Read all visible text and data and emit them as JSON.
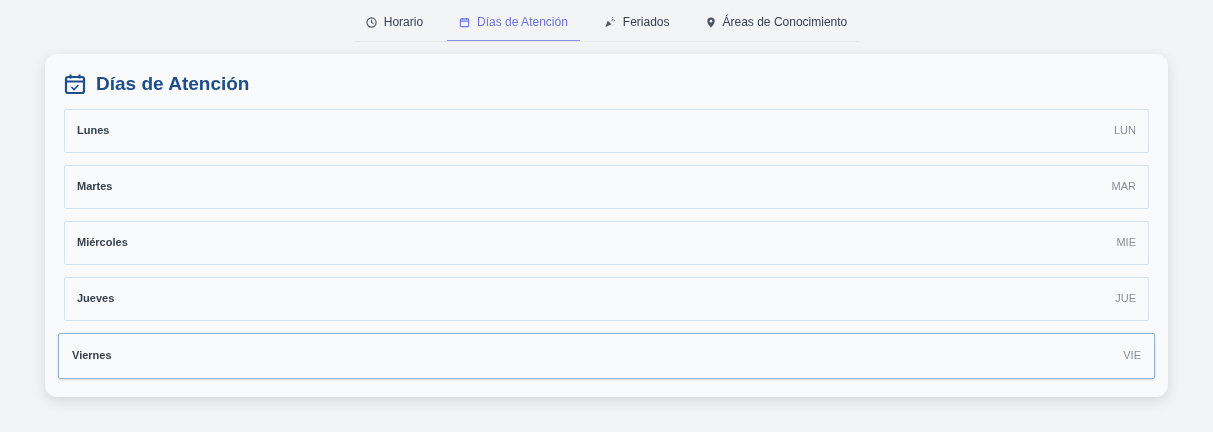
{
  "tabs": [
    {
      "label": "Horario",
      "selected": false
    },
    {
      "label": "Días de Atención",
      "selected": true
    },
    {
      "label": "Feriados",
      "selected": false
    },
    {
      "label": "Áreas de Conocimiento",
      "selected": false
    }
  ],
  "panel": {
    "title": "Días de Atención"
  },
  "days": [
    {
      "name": "Lunes",
      "abbr": "LUN",
      "selected": false
    },
    {
      "name": "Martes",
      "abbr": "MAR",
      "selected": false
    },
    {
      "name": "Miércoles",
      "abbr": "MIE",
      "selected": false
    },
    {
      "name": "Jueves",
      "abbr": "JUE",
      "selected": false
    },
    {
      "name": "Viernes",
      "abbr": "VIE",
      "selected": true
    }
  ]
}
